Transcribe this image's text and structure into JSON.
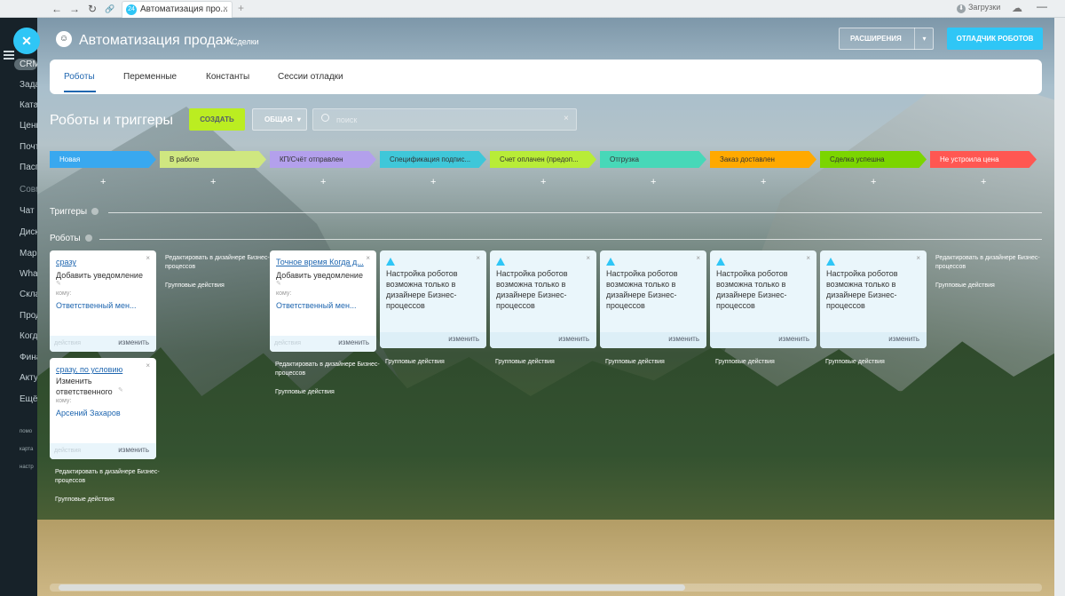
{
  "browser": {
    "back_glyph": "←",
    "forward_glyph": "→",
    "reload_glyph": "↻",
    "link_glyph": "🔗",
    "tab_favicon": "24",
    "tab_title": "Автоматизация про...",
    "tab_close": "×",
    "new_tab": "+",
    "downloads_glyph": "⬇",
    "downloads": "Загрузки",
    "cloud_glyph": "☁",
    "minimize_glyph": "—"
  },
  "sidebar": {
    "close_glyph": "✕",
    "items": [
      "CRM",
      "Зада",
      "Ката",
      "Цени",
      "Почт",
      "Пасп",
      "Совм",
      "Чат и",
      "Диск",
      "Мар",
      "Wha",
      "Скла",
      "Прод",
      "Когд",
      "Фина",
      "Акту",
      "Ещё"
    ],
    "small_items": [
      "помо",
      "карта",
      "настр"
    ]
  },
  "header": {
    "logo_glyph": "☺",
    "title": "Автоматизация продаж",
    "entity": "Сделки",
    "extensions_button": "РАСШИРЕНИЯ",
    "extensions_caret": "▾",
    "debug_button": "ОТЛАДЧИК РОБОТОВ"
  },
  "tabs": [
    "Роботы",
    "Переменные",
    "Константы",
    "Сессии отладки"
  ],
  "toolbar": {
    "title": "Роботы и триггеры",
    "create_button": "СОЗДАТЬ",
    "filter_button": "ОБЩАЯ",
    "filter_caret": "▾",
    "search_placeholder": "поиск",
    "search_clear": "×"
  },
  "stages": [
    {
      "name": "Новая",
      "color": "#39a8ef"
    },
    {
      "name": "В работе",
      "color": "#cfe780"
    },
    {
      "name": "КП/Счёт отправлен",
      "color": "#b3a0ec"
    },
    {
      "name": "Спецификация подпис...",
      "color": "#3fc7d9"
    },
    {
      "name": "Счет оплачен (предоп...",
      "color": "#b8ec37"
    },
    {
      "name": "Отгрузка",
      "color": "#47d8b8"
    },
    {
      "name": "Заказ доставлен",
      "color": "#ffa900"
    },
    {
      "name": "Сделка успешна",
      "color": "#7bd500"
    },
    {
      "name": "Не устроила цена",
      "color": "#ff5752"
    }
  ],
  "plus_glyph": "+",
  "sections": {
    "triggers": "Триггеры",
    "robots": "Роботы"
  },
  "robot_cards": {
    "card1": {
      "condition": "сразу",
      "title": "Добавить уведомление",
      "pencil": "✎",
      "to": "кому:",
      "responsible": "Ответственный мен...",
      "actions": "действия",
      "edit": "изменить",
      "close": "×"
    },
    "card2": {
      "condition": "сразу, по условию",
      "title": "Изменить ответственного",
      "pencil": "✎",
      "to": "кому:",
      "responsible": "Арсений Захаров",
      "actions": "действия",
      "edit": "изменить",
      "close": "×"
    },
    "card3": {
      "condition": "Точное время Когда д...",
      "title": "Добавить уведомление",
      "pencil": "✎",
      "to": "кому:",
      "responsible": "Ответственный мен...",
      "actions": "действия",
      "edit": "изменить",
      "close": "×"
    }
  },
  "warning_card": {
    "text": "Настройка роботов возможна только в дизайнере Бизнес-процессов",
    "edit": "изменить",
    "close": "×"
  },
  "column_links": {
    "edit_in_designer": "Редактировать в дизайнере Бизнес-процессов",
    "group_actions": "Групповые действия"
  }
}
